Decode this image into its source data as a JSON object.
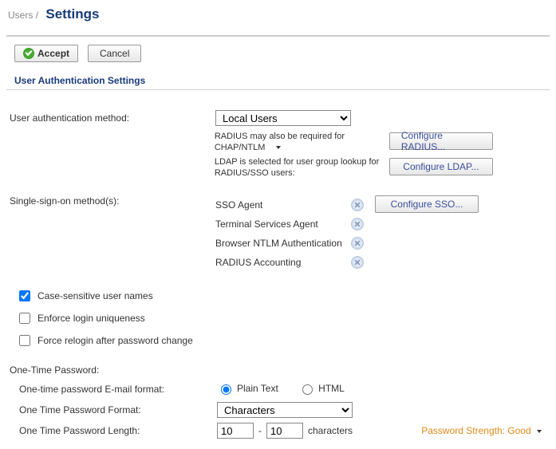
{
  "breadcrumb": {
    "parent": "Users",
    "sep": "/",
    "title": "Settings"
  },
  "toolbar": {
    "accept": "Accept",
    "cancel": "Cancel"
  },
  "section": {
    "title": "User Authentication Settings"
  },
  "auth": {
    "method_label": "User authentication method:",
    "method_value": "Local Users",
    "radius_note": "RADIUS may also be required for CHAP/NTLM",
    "ldap_note": "LDAP is selected for user group lookup for RADIUS/SSO users:",
    "configure_radius": "Configure RADIUS...",
    "configure_ldap": "Configure LDAP..."
  },
  "sso": {
    "label": "Single-sign-on method(s):",
    "configure": "Configure SSO...",
    "methods": [
      "SSO Agent",
      "Terminal Services Agent",
      "Browser NTLM Authentication",
      "RADIUS Accounting"
    ]
  },
  "checks": {
    "case_sensitive": {
      "label": "Case-sensitive user names",
      "checked": true
    },
    "enforce_unique": {
      "label": "Enforce login uniqueness",
      "checked": false
    },
    "force_relogin": {
      "label": "Force relogin after password change",
      "checked": false
    }
  },
  "otp": {
    "heading": "One-Time Password:",
    "email_format_label": "One-time password E-mail format:",
    "email_format_plain": "Plain Text",
    "email_format_html": "HTML",
    "format_label": "One Time Password Format:",
    "format_value": "Characters",
    "length_label": "One Time Password Length:",
    "length_min": "10",
    "length_sep": "-",
    "length_max": "10",
    "length_unit": "characters",
    "strength": "Password Strength: Good"
  }
}
